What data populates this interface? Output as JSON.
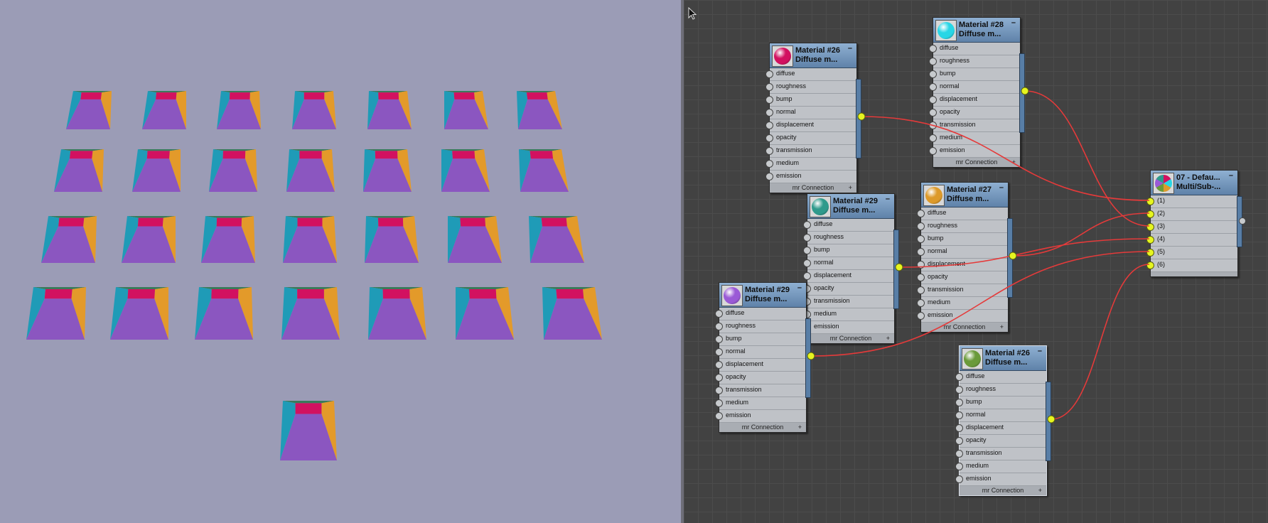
{
  "viewport": {
    "background": "#9b9cb6",
    "face_colors": {
      "top": "#d21160",
      "left": "#1f9bb7",
      "right": "#e39a2a",
      "front": "#8b56c0",
      "back": "#3a7a5a"
    }
  },
  "editor": {
    "background": "#424242",
    "wire_color": "#e53a3a",
    "socket_color": "#e6f520",
    "slots": [
      "diffuse",
      "roughness",
      "bump",
      "normal",
      "displacement",
      "opacity",
      "transmission",
      "medium",
      "emission"
    ],
    "connection_label": "mr Connection",
    "plus_symbol": "+",
    "minimize_symbol": "–",
    "nodes": [
      {
        "line1": "Material #26",
        "line2": "Diffuse m...",
        "color": "#d21160"
      },
      {
        "line1": "Material #28",
        "line2": "Diffuse m...",
        "color": "#28d6e6"
      },
      {
        "line1": "Material #29",
        "line2": "Diffuse m...",
        "color": "#2f9a8c"
      },
      {
        "line1": "Material #27",
        "line2": "Diffuse m...",
        "color": "#dd9a2a"
      },
      {
        "line1": "Material #29",
        "line2": "Diffuse m...",
        "color": "#9a5ad6"
      },
      {
        "line1": "Material #26",
        "line2": "Diffuse m...",
        "color": "#6a9a3a"
      }
    ],
    "multi": {
      "line1": "07 - Defau...",
      "line2": "Multi/Sub-...",
      "slots": [
        "(1)",
        "(2)",
        "(3)",
        "(4)",
        "(5)",
        "(6)"
      ]
    }
  }
}
